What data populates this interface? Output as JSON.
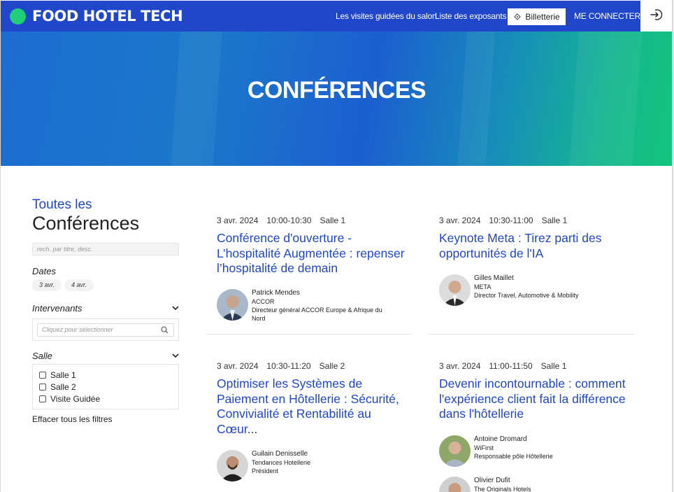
{
  "brand": {
    "name": "FOOD HOTEL TECH",
    "accent": "#2046c9",
    "dot_color": "#1ecf78"
  },
  "nav": {
    "visites": "Les visites guidées du salon",
    "exposants": "Liste des exposants",
    "billetterie": "Billetterie",
    "connect": "ME CONNECTER",
    "login_icon": "login-arrow-icon"
  },
  "hero": {
    "title": "CONFÉRENCES"
  },
  "sidebar": {
    "title_line1": "Toutes les",
    "title_line2": "Conférences",
    "search_placeholder": "rech. par titre, desc.",
    "dates_label": "Dates",
    "dates": [
      "3 avr.",
      "4 avr."
    ],
    "intervenants_label": "Intervenants",
    "intervenants_placeholder": "Cliquez pour sélectionner",
    "salle_label": "Salle",
    "salles": [
      "Salle 1",
      "Salle 2",
      "Visite Guidée"
    ],
    "clear": "Effacer tous les filtres"
  },
  "conferences": [
    {
      "date": "3 avr. 2024",
      "time": "10:00-10:30",
      "room": "Salle 1",
      "title": "Conférence d'ouverture - L’hospitalité Augmentée : repenser l’hospitalité de demain",
      "speakers": [
        {
          "name": "Patrick Mendes",
          "company": "ACCOR",
          "role": "Directeur général ACCOR Europe & Afrique du Nord"
        }
      ]
    },
    {
      "date": "3 avr. 2024",
      "time": "10:30-11:00",
      "room": "Salle 1",
      "title": "Keynote Meta : Tirez parti des opportunités de l'IA",
      "speakers": [
        {
          "name": "Gilles Maillet",
          "company": "META",
          "role": "Director Travel, Automotive & Mobility"
        }
      ]
    },
    {
      "date": "3 avr. 2024",
      "time": "10:30-11:20",
      "room": "Salle 2",
      "title": "Optimiser les Systèmes de Paiement en Hôtellerie : Sécurité, Convivialité et Rentabilité au Cœur...",
      "speakers": [
        {
          "name": "Guilain Denisselle",
          "company": "Tendances Hotellerie",
          "role": "Président"
        }
      ]
    },
    {
      "date": "3 avr. 2024",
      "time": "11:00-11:50",
      "room": "Salle 1",
      "title": "Devenir incontournable : comment l'expérience client fait la différence dans l'hôtellerie",
      "speakers": [
        {
          "name": "Antoine Dromard",
          "company": "WiFirst",
          "role": "Responsable pôle Hôtellerie"
        },
        {
          "name": "Olivier Dufit",
          "company": "The Originals Hotels",
          "role": ""
        }
      ]
    }
  ]
}
